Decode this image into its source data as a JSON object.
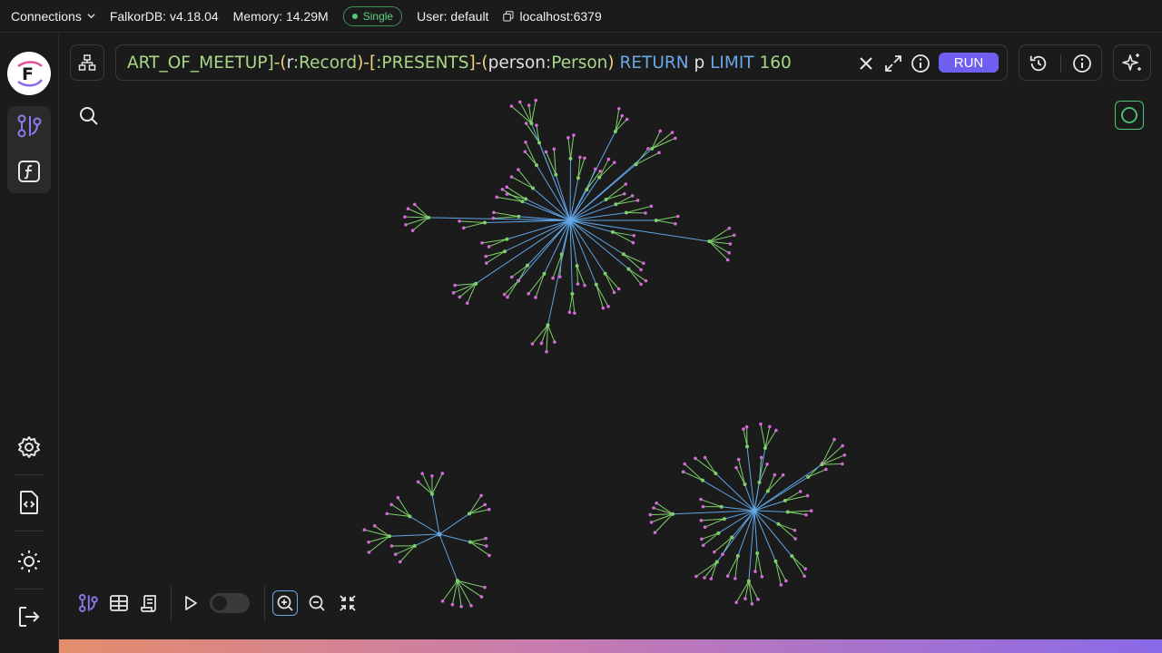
{
  "topbar": {
    "connections_label": "Connections",
    "version": "FalkorDB: v4.18.04",
    "memory": "Memory: 14.29M",
    "mode_badge": "Single",
    "user": "User: default",
    "host": "localhost:6379"
  },
  "sidebar": {
    "logo_letter": "F",
    "items": [
      {
        "name": "graph-view",
        "icon": "graph-nodes-icon"
      },
      {
        "name": "functions",
        "icon": "function-icon"
      },
      {
        "name": "settings",
        "icon": "gear-icon"
      },
      {
        "name": "docs",
        "icon": "code-file-icon"
      },
      {
        "name": "theme",
        "icon": "sun-icon"
      },
      {
        "name": "logout",
        "icon": "logout-icon"
      }
    ]
  },
  "query": {
    "tokens": [
      {
        "t": "ART_OF_MEETUP]",
        "c": "q-str"
      },
      {
        "t": "-(",
        "c": "q-op"
      },
      {
        "t": "r",
        "c": "q-var"
      },
      {
        "t": ":Record",
        "c": "q-lbl"
      },
      {
        "t": ")-[",
        "c": "q-op"
      },
      {
        "t": ":PRESENTS",
        "c": "q-lbl"
      },
      {
        "t": "]-(",
        "c": "q-op"
      },
      {
        "t": "person",
        "c": "q-var"
      },
      {
        "t": ":Person",
        "c": "q-lbl"
      },
      {
        "t": ") ",
        "c": "q-op"
      },
      {
        "t": "RETURN",
        "c": "q-kw"
      },
      {
        "t": " p ",
        "c": "q-var"
      },
      {
        "t": "LIMIT",
        "c": "q-kw"
      },
      {
        "t": " 160",
        "c": "q-num"
      }
    ],
    "run_label": "RUN"
  },
  "colors": {
    "accent": "#6e5ff0",
    "status_green": "#4fc777",
    "node_hub": "#6aa8e8",
    "node_mid": "#7fd06a",
    "node_leaf": "#d46ad8",
    "edge_hub": "#5fa4e6",
    "edge_leaf": "#7fd06a"
  },
  "bottom_toolbar": {
    "icons": [
      "graph-view-icon",
      "table-icon",
      "metadata-icon",
      "play-icon",
      "animation-toggle",
      "zoom-in-icon",
      "zoom-out-icon",
      "fit-center-icon"
    ]
  }
}
